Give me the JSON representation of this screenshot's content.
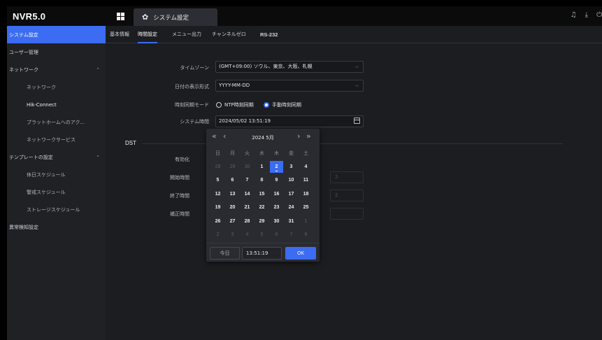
{
  "app": {
    "logo": "NVR5.0"
  },
  "topbar": {
    "active_tab": "システム設定",
    "icons": [
      "bell-icon",
      "download-icon",
      "power-icon"
    ]
  },
  "sidebar": {
    "items": [
      {
        "label": "システム設定",
        "active": true
      },
      {
        "label": "ユーザー管理"
      },
      {
        "label": "ネットワーク",
        "expandable": true
      },
      {
        "label": "ネットワーク",
        "sub": true
      },
      {
        "label": "Hik-Connect",
        "sub": true
      },
      {
        "label": "プラットホームへのアク...",
        "sub": true
      },
      {
        "label": "ネットワークサービス",
        "sub": true
      },
      {
        "label": "テンプレートの設定",
        "expandable": true
      },
      {
        "label": "休日スケジュール",
        "sub": true
      },
      {
        "label": "警戒スケジュール",
        "sub": true
      },
      {
        "label": "ストレージスケジュール",
        "sub": true
      },
      {
        "label": "異常検知設定"
      }
    ]
  },
  "tabs": [
    "基本情報",
    "時間設定",
    "メニュー出力",
    "チャンネルゼロ",
    "RS-232"
  ],
  "active_tab_index": 1,
  "form": {
    "timezone_label": "タイムゾーン",
    "timezone_value": "(GMT+09:00) ソウル、東京、大阪、札幌",
    "date_format_label": "日付の表示形式",
    "date_format_value": "YYYY-MM-DD",
    "sync_mode_label": "時刻同期モード",
    "sync_ntp": "NTP時刻同期",
    "sync_manual": "手動時刻同期",
    "system_time_label": "システム時間",
    "system_time_value": "2024/05/02 13:51:19",
    "dst_title": "DST",
    "dst_enable_label": "有効化",
    "dst_start_label": "開始時間",
    "dst_end_label": "終了時間",
    "dst_offset_label": "補正時間",
    "dst_start_value": "2",
    "dst_end_value": "2"
  },
  "calendar": {
    "title": "2024 5月",
    "weekdays": [
      "日",
      "月",
      "火",
      "水",
      "木",
      "金",
      "土"
    ],
    "days": [
      [
        "28",
        "29",
        "30",
        "1",
        "2",
        "3",
        "4"
      ],
      [
        "5",
        "6",
        "7",
        "8",
        "9",
        "10",
        "11"
      ],
      [
        "12",
        "13",
        "14",
        "15",
        "16",
        "17",
        "18"
      ],
      [
        "19",
        "20",
        "21",
        "22",
        "23",
        "24",
        "25"
      ],
      [
        "26",
        "27",
        "28",
        "29",
        "30",
        "31",
        "1"
      ],
      [
        "2",
        "3",
        "4",
        "5",
        "6",
        "7",
        "8"
      ]
    ],
    "muted": [
      [
        0,
        0
      ],
      [
        0,
        1
      ],
      [
        0,
        2
      ],
      [
        4,
        6
      ],
      [
        5,
        0
      ],
      [
        5,
        1
      ],
      [
        5,
        2
      ],
      [
        5,
        3
      ],
      [
        5,
        4
      ],
      [
        5,
        5
      ],
      [
        5,
        6
      ]
    ],
    "selected": [
      0,
      4
    ],
    "today_label": "今日",
    "time_value": "13:51:19",
    "ok_label": "OK"
  },
  "colors": {
    "accent": "#3b6cf2",
    "background": "#1c1d20",
    "sidebar": "#202125",
    "topbar": "#0b0b0c"
  }
}
